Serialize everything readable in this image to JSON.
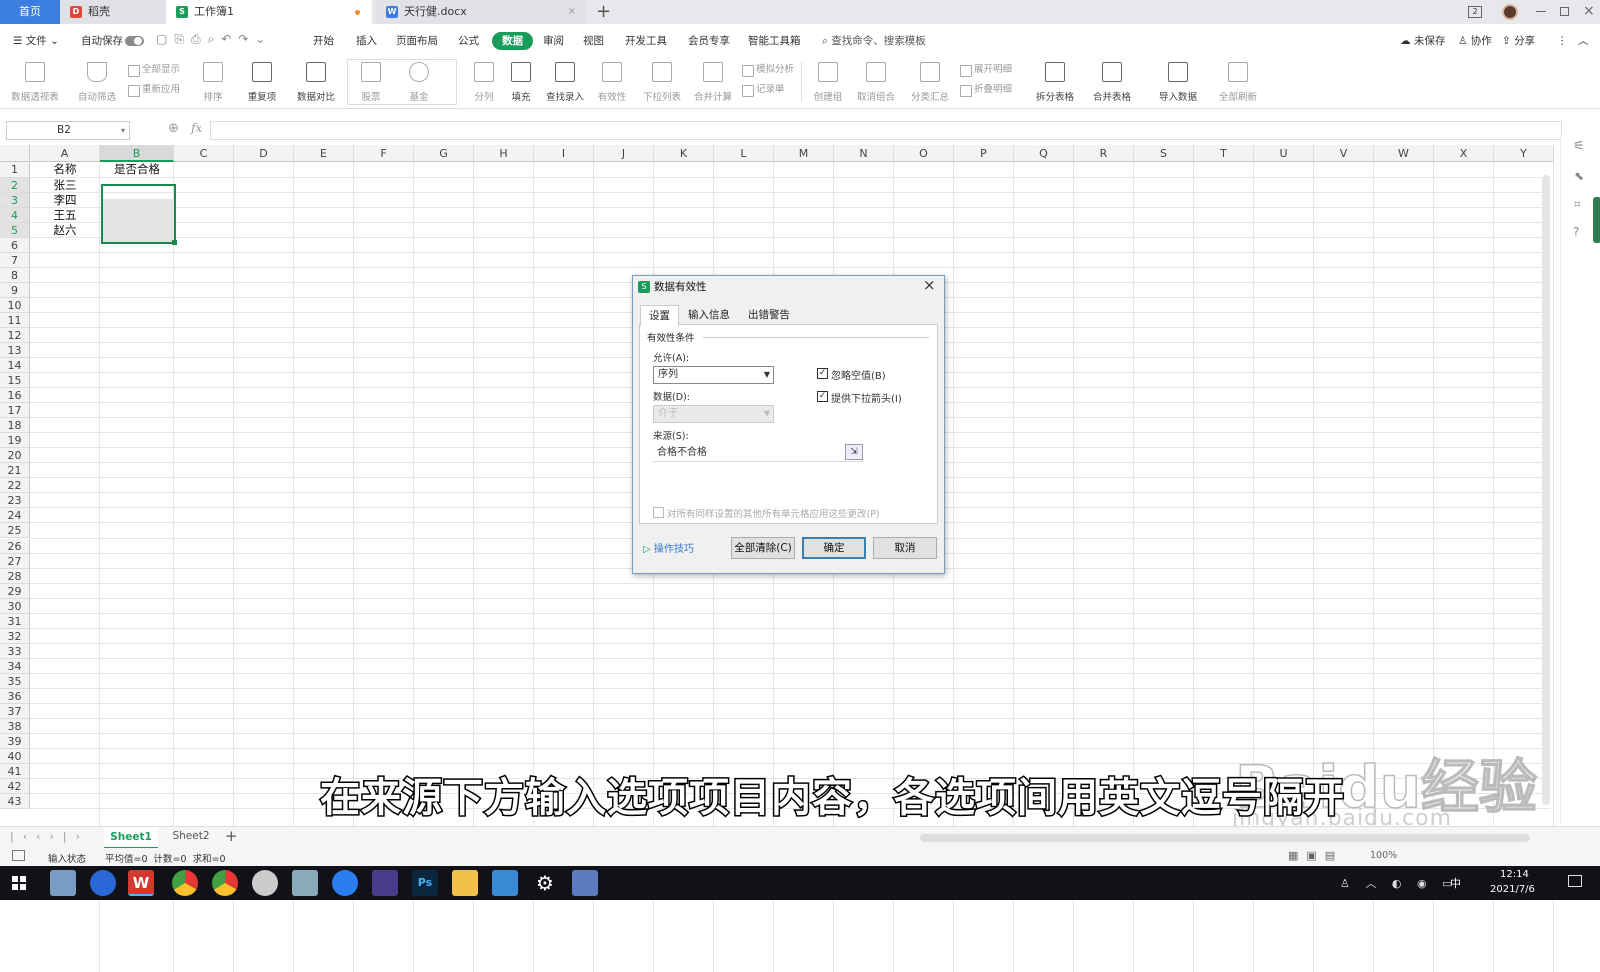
{
  "tabs": [
    {
      "label": "首页",
      "icon": "home"
    },
    {
      "label": "稻壳",
      "icon": "docer-icon"
    },
    {
      "label": "工作簿1",
      "icon": "sheet-icon"
    },
    {
      "label": "天行健.docx",
      "icon": "word-icon"
    }
  ],
  "menu": {
    "file": "文件",
    "autosave": "自动保存",
    "items": [
      "开始",
      "插入",
      "页面布局",
      "公式",
      "数据",
      "审阅",
      "视图",
      "开发工具",
      "会员专享",
      "智能工具箱"
    ],
    "active": "数据",
    "search": "查找命令、搜索模板",
    "right": [
      "未保存",
      "协作",
      "分享"
    ]
  },
  "ribbon": {
    "buttons": [
      "数据透视表",
      "自动筛选",
      "排序",
      "重复项",
      "数据对比",
      "股票",
      "基金",
      "分列",
      "填充",
      "查找录入",
      "有效性",
      "下拉列表",
      "合并计算",
      "创建组",
      "取消组合",
      "分类汇总",
      "拆分表格",
      "合并表格",
      "导入数据",
      "全部刷新"
    ],
    "small": [
      "全部显示",
      "重新应用",
      "模拟分析",
      "记录单",
      "展开明细",
      "折叠明细"
    ]
  },
  "formula": {
    "namebox": "B2",
    "fx": "fx"
  },
  "grid": {
    "columns": [
      "A",
      "B",
      "C",
      "D",
      "E",
      "F",
      "G",
      "H",
      "I",
      "J",
      "K",
      "L",
      "M",
      "N",
      "O",
      "P",
      "Q",
      "R",
      "S",
      "T",
      "U",
      "V",
      "W",
      "X",
      "Y"
    ],
    "rows_count": 43,
    "cells": {
      "A1": "名称",
      "B1": "是否合格",
      "A2": "张三",
      "A3": "李四",
      "A4": "王五",
      "A5": "赵六"
    }
  },
  "dialog": {
    "title": "数据有效性",
    "tabs": [
      "设置",
      "输入信息",
      "出错警告"
    ],
    "section": "有效性条件",
    "allow_label": "允许(A):",
    "allow_value": "序列",
    "data_label": "数据(D):",
    "data_value": "介于",
    "ignore_blank": "忽略空值(B)",
    "dropdown_arrow": "提供下拉箭头(I)",
    "source_label": "来源(S):",
    "source_value": "合格不合格",
    "apply_all": "对所有同样设置的其他所有单元格应用这些更改(P)",
    "tips": "操作技巧",
    "clear_all": "全部清除(C)",
    "ok": "确定",
    "cancel": "取消"
  },
  "sheets": [
    "Sheet1",
    "Sheet2"
  ],
  "status": {
    "mode": "输入状态",
    "stats": "平均值=0  计数=0  求和=0",
    "zoom": "100%"
  },
  "taskbar": {
    "time": "12:14",
    "date": "2021/7/6",
    "ime": "中"
  },
  "subtitle": "在来源下方输入选项项目内容，各选项间用英文逗号隔开",
  "watermark": "Baidu经验",
  "watermark_url": "jingyan.baidu.com",
  "colors": {
    "accent": "#1a9c5b",
    "tabblue": "#3b7de0",
    "selection": "#1b8a4e"
  }
}
